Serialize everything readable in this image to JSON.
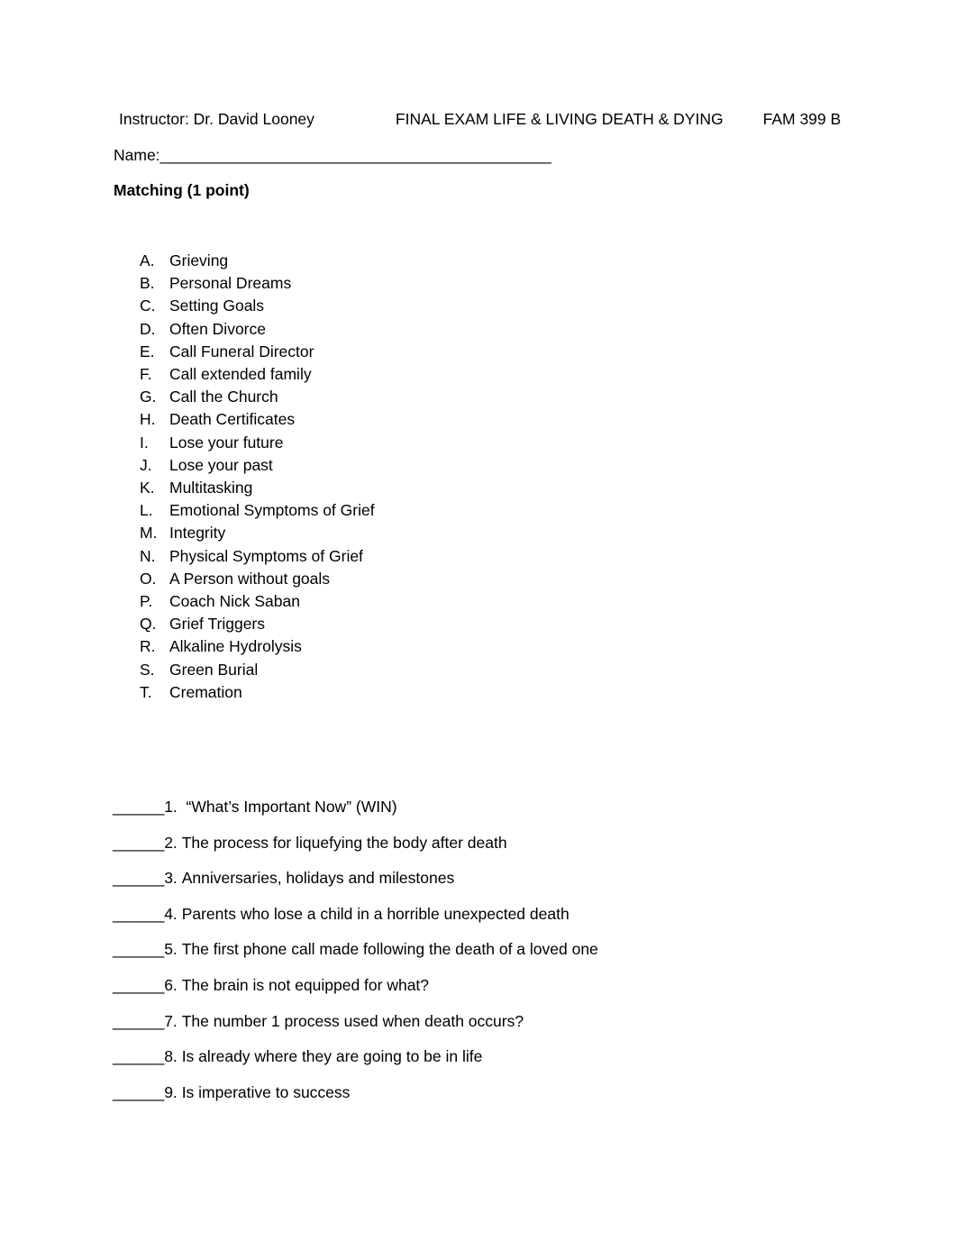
{
  "document": {
    "header": {
      "instructor": "Instructor: Dr. David Looney",
      "exam_title": "FINAL EXAM LIFE & LIVING DEATH & DYING",
      "course_code": "FAM 399 B"
    },
    "name_field": {
      "label": "Name:",
      "blank": "______________________________________________"
    },
    "section_heading": "Matching (1 point)",
    "matching_options": [
      {
        "letter": "A.",
        "text": "Grieving"
      },
      {
        "letter": "B.",
        "text": "Personal Dreams"
      },
      {
        "letter": "C.",
        "text": "Setting Goals"
      },
      {
        "letter": "D.",
        "text": "Often Divorce"
      },
      {
        "letter": "E.",
        "text": "Call Funeral Director"
      },
      {
        "letter": "F.",
        "text": "Call extended family"
      },
      {
        "letter": "G.",
        "text": "Call the Church"
      },
      {
        "letter": "H.",
        "text": "Death Certificates"
      },
      {
        "letter": "I.",
        "text": "Lose your future"
      },
      {
        "letter": "J.",
        "text": "Lose your past"
      },
      {
        "letter": "K.",
        "text": "Multitasking"
      },
      {
        "letter": "L.",
        "text": "Emotional Symptoms of Grief"
      },
      {
        "letter": "M.",
        "text": "Integrity"
      },
      {
        "letter": "N.",
        "text": "Physical Symptoms of Grief"
      },
      {
        "letter": "O.",
        "text": "A Person without goals"
      },
      {
        "letter": "P.",
        "text": "Coach Nick Saban"
      },
      {
        "letter": "Q.",
        "text": "Grief Triggers"
      },
      {
        "letter": "R.",
        "text": "Alkaline Hydrolysis"
      },
      {
        "letter": "S.",
        "text": "Green Burial"
      },
      {
        "letter": "T.",
        "text": "Cremation"
      }
    ],
    "questions": [
      {
        "blank": "______",
        "number": "1.",
        "text": "“What’s Important Now” (WIN)"
      },
      {
        "blank": "______",
        "number": "2.",
        "text": "The process for liquefying the body after death"
      },
      {
        "blank": "______",
        "number": "3.",
        "text": "Anniversaries, holidays and milestones"
      },
      {
        "blank": "______",
        "number": "4.",
        "text": "Parents who lose a child in a horrible unexpected death"
      },
      {
        "blank": "______",
        "number": "5.",
        "text": "The first phone call made following the death of a loved one"
      },
      {
        "blank": "______",
        "number": "6.",
        "text": "The brain is not equipped for what?"
      },
      {
        "blank": "______",
        "number": "7.",
        "text": "The number 1 process used when death occurs?"
      },
      {
        "blank": "______",
        "number": "8.",
        "text": "Is already where they are going to be in life"
      },
      {
        "blank": "______",
        "number": "9.",
        "text": "Is imperative to success"
      }
    ]
  }
}
